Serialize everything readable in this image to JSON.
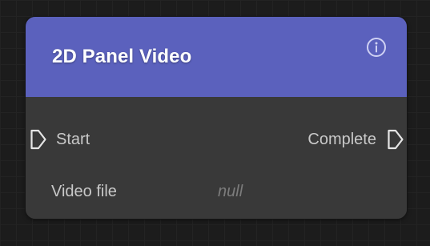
{
  "node": {
    "title": "2D Panel Video",
    "header_color": "#5b61bd",
    "body_color": "#393939",
    "info_icon": "info-circle-icon",
    "ports": {
      "input": {
        "label": "Start",
        "icon": "flow-port-in-icon"
      },
      "output": {
        "label": "Complete",
        "icon": "flow-port-out-icon"
      }
    },
    "fields": [
      {
        "label": "Video file",
        "value": "null"
      }
    ]
  }
}
